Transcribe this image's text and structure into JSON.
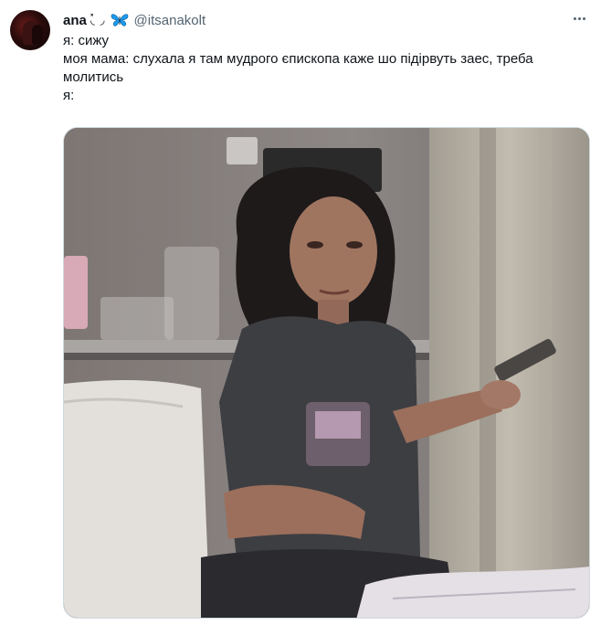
{
  "tweet": {
    "author": {
      "display_name": "ana",
      "name_decoration": "◟̽ ◞",
      "badge_icon": "butterfly-icon",
      "handle": "@itsanakolt"
    },
    "text_lines": [
      "я: сижу",
      "моя мама: слухала я там мудрого єпископа каже шо підірвуть заес, треба молитись",
      "я:"
    ],
    "media": {
      "type": "photo",
      "accent_colors": [
        "#6e6a66",
        "#8b8483",
        "#3c3a3a"
      ]
    },
    "colors": {
      "text": "#0f1419",
      "secondary": "#536471",
      "border": "#cfd9de",
      "butterfly": "#1d9bf0"
    }
  }
}
